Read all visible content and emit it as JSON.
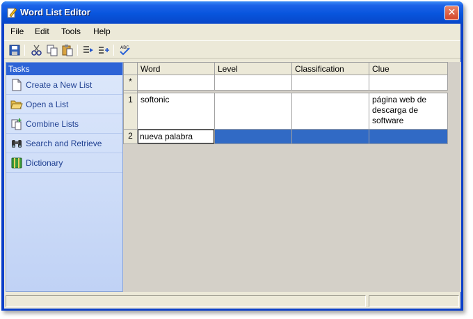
{
  "window": {
    "title": "Word List Editor"
  },
  "menu": [
    "File",
    "Edit",
    "Tools",
    "Help"
  ],
  "toolbar": [
    "save-icon",
    "cut-icon",
    "copy-icon",
    "paste-icon",
    "move-right-icon",
    "insert-row-icon",
    "spellcheck-icon"
  ],
  "tasks": {
    "header": "Tasks",
    "items": [
      {
        "label": "Create a New List",
        "icon": "new-document-icon"
      },
      {
        "label": "Open a List",
        "icon": "open-folder-icon"
      },
      {
        "label": "Combine Lists",
        "icon": "combine-icon"
      },
      {
        "label": "Search and Retrieve",
        "icon": "binoculars-icon"
      },
      {
        "label": "Dictionary",
        "icon": "book-icon"
      }
    ]
  },
  "grid": {
    "columns": [
      "Word",
      "Level",
      "Classification",
      "Clue"
    ],
    "new_row_marker": "*",
    "rows": [
      {
        "num": "1",
        "word": "softonic",
        "level": "",
        "classification": "",
        "clue": "página web de descarga de software"
      },
      {
        "num": "2",
        "word": "nueva palabra",
        "level": "",
        "classification": "",
        "clue": ""
      }
    ]
  },
  "colors": {
    "title_blue": "#0855dd",
    "selection": "#316ac5",
    "task_header": "#2d63d6"
  }
}
